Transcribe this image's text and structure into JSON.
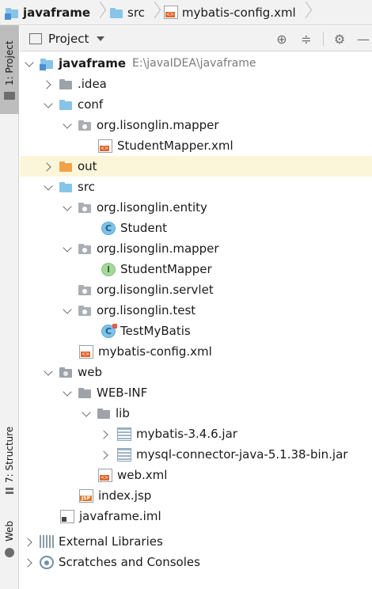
{
  "breadcrumb": {
    "items": [
      {
        "label": "javaframe",
        "icon": "module-folder-icon"
      },
      {
        "label": "src",
        "icon": "source-folder-icon"
      },
      {
        "label": "mybatis-config.xml",
        "icon": "xml-file-icon"
      }
    ]
  },
  "tool_stripe": {
    "project_tab": "1: Project",
    "structure_tab": "7: Structure",
    "web_tab": "Web"
  },
  "panel": {
    "title": "Project",
    "dropdown_icon": "chevron-down-icon",
    "actions": [
      "locate-icon",
      "collapse-all-icon",
      "settings-gear-icon",
      "hide-icon"
    ]
  },
  "tree": [
    {
      "label": "javaframe",
      "path": "E:\\javaIDEA\\javaframe",
      "icon": "module-folder-icon",
      "expanded": true,
      "bold": true
    },
    {
      "label": ".idea",
      "icon": "folder-icon",
      "expanded": false
    },
    {
      "label": "conf",
      "icon": "resource-folder-icon",
      "expanded": true
    },
    {
      "label": "org.lisonglin.mapper",
      "icon": "package-icon",
      "expanded": true
    },
    {
      "label": "StudentMapper.xml",
      "icon": "xml-file-icon"
    },
    {
      "label": "out",
      "icon": "excluded-folder-icon",
      "expanded": false,
      "highlighted": true
    },
    {
      "label": "src",
      "icon": "source-folder-icon",
      "expanded": true
    },
    {
      "label": "org.lisonglin.entity",
      "icon": "package-icon",
      "expanded": true
    },
    {
      "label": "Student",
      "icon": "class-icon",
      "glyph": "C"
    },
    {
      "label": "org.lisonglin.mapper",
      "icon": "package-icon",
      "expanded": true
    },
    {
      "label": "StudentMapper",
      "icon": "interface-icon",
      "glyph": "I"
    },
    {
      "label": "org.lisonglin.servlet",
      "icon": "package-icon"
    },
    {
      "label": "org.lisonglin.test",
      "icon": "package-icon",
      "expanded": true
    },
    {
      "label": "TestMyBatis",
      "icon": "test-class-icon",
      "glyph": "C"
    },
    {
      "label": "mybatis-config.xml",
      "icon": "xml-file-icon"
    },
    {
      "label": "web",
      "icon": "web-folder-icon",
      "expanded": true
    },
    {
      "label": "WEB-INF",
      "icon": "folder-icon",
      "expanded": true
    },
    {
      "label": "lib",
      "icon": "folder-icon",
      "expanded": true
    },
    {
      "label": "mybatis-3.4.6.jar",
      "icon": "jar-icon",
      "expanded": false
    },
    {
      "label": "mysql-connector-java-5.1.38-bin.jar",
      "icon": "jar-icon",
      "expanded": false
    },
    {
      "label": "web.xml",
      "icon": "web-xml-icon"
    },
    {
      "label": "index.jsp",
      "icon": "jsp-file-icon",
      "file_badge": "JSP"
    },
    {
      "label": "javaframe.iml",
      "icon": "iml-file-icon"
    },
    {
      "label": "External Libraries",
      "icon": "libraries-icon",
      "expanded": false
    },
    {
      "label": "Scratches and Consoles",
      "icon": "scratches-icon",
      "expanded": false
    }
  ],
  "colors": {
    "highlight_row": "#fbf6d9",
    "source_folder": "#87c4e8",
    "excluded_folder": "#f2a14a",
    "package": "#a9afb4",
    "class": "#7ec3e8",
    "interface": "#a7d89b"
  }
}
